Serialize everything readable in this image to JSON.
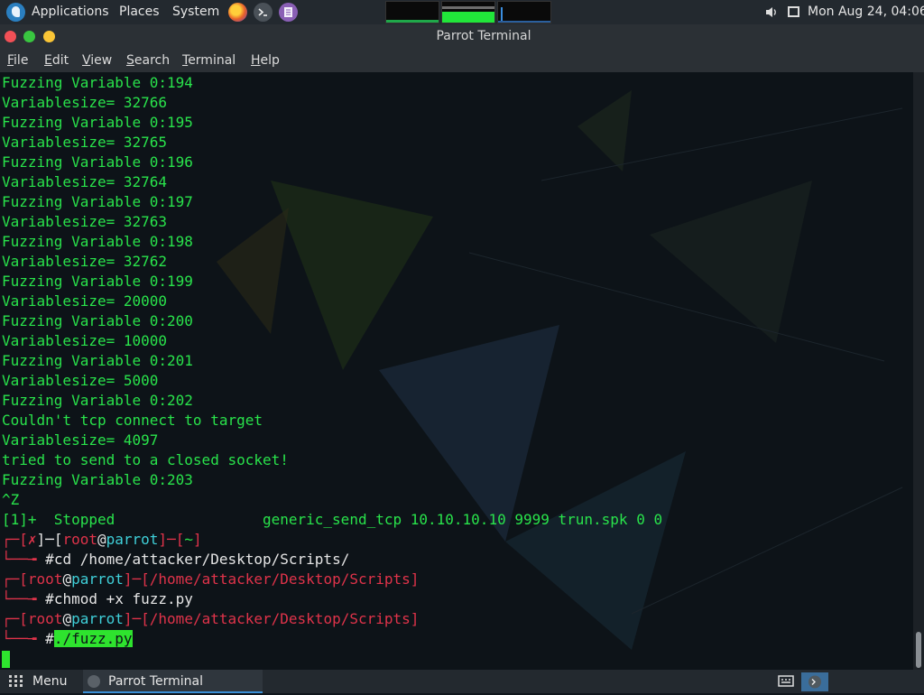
{
  "top_panel": {
    "applications": "Applications",
    "places": "Places",
    "system": "System",
    "clock": "Mon Aug 24, 04:06",
    "icons": [
      "parrot-logo-icon",
      "firefox-icon",
      "terminal-launcher-icon",
      "text-editor-icon",
      "volume-icon",
      "network-icon"
    ]
  },
  "window": {
    "title": "Parrot Terminal",
    "menu": [
      "File",
      "Edit",
      "View",
      "Search",
      "Terminal",
      "Help"
    ]
  },
  "terminal": {
    "lines": [
      "Fuzzing Variable 0:194",
      "Variablesize= 32766",
      "Fuzzing Variable 0:195",
      "Variablesize= 32765",
      "Fuzzing Variable 0:196",
      "Variablesize= 32764",
      "Fuzzing Variable 0:197",
      "Variablesize= 32763",
      "Fuzzing Variable 0:198",
      "Variablesize= 32762",
      "Fuzzing Variable 0:199",
      "Variablesize= 20000",
      "Fuzzing Variable 0:200",
      "Variablesize= 10000",
      "Fuzzing Variable 0:201",
      "Variablesize= 5000",
      "Fuzzing Variable 0:202",
      "Couldn't tcp connect to target",
      "Variablesize= 4097",
      "tried to send to a closed socket!",
      "Fuzzing Variable 0:203",
      "^Z",
      "[1]+  Stopped                 generic_send_tcp 10.10.10.10 9999 trun.spk 0 0"
    ],
    "prompts": [
      {
        "status": "✗",
        "user": "root",
        "at": "@",
        "host": "parrot",
        "path": "~",
        "command": "cd /home/attacker/Desktop/Scripts/"
      },
      {
        "status": "",
        "user": "root",
        "at": "@",
        "host": "parrot",
        "path": "/home/attacker/Desktop/Scripts",
        "command": "chmod +x fuzz.py"
      },
      {
        "status": "",
        "user": "root",
        "at": "@",
        "host": "parrot",
        "path": "/home/attacker/Desktop/Scripts",
        "command": "./fuzz.py"
      }
    ],
    "prompt_symbol": "#"
  },
  "bottom_panel": {
    "menu": "Menu",
    "task": "Parrot Terminal"
  },
  "colors": {
    "terminal_text": "#29e34b",
    "prompt_red": "#e0334a",
    "prompt_cyan": "#3fd0d9",
    "panel_bg": "#23292f"
  }
}
